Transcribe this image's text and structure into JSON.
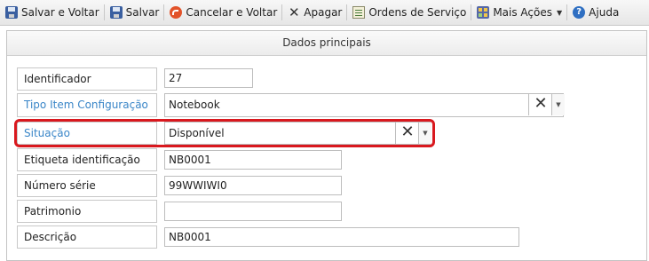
{
  "toolbar": {
    "save_back": "Salvar e Voltar",
    "save": "Salvar",
    "cancel_back": "Cancelar e Voltar",
    "delete": "Apagar",
    "service_orders": "Ordens de Serviço",
    "more_actions": "Mais Ações",
    "help": "Ajuda"
  },
  "panel": {
    "title": "Dados principais"
  },
  "form": {
    "identificador": {
      "label": "Identificador",
      "value": "27"
    },
    "tipo_item": {
      "label": "Tipo Item Configuração",
      "value": "Notebook"
    },
    "situacao": {
      "label": "Situação",
      "value": "Disponível"
    },
    "etiqueta": {
      "label": "Etiqueta identificação",
      "value": "NB0001"
    },
    "numero_serie": {
      "label": "Número série",
      "value": "99WWIWI0"
    },
    "patrimonio": {
      "label": "Patrimonio",
      "value": ""
    },
    "descricao": {
      "label": "Descrição",
      "value": "NB0001"
    }
  },
  "colors": {
    "link_label": "#3a86c8",
    "highlight": "#d9181e"
  },
  "icons": {
    "save_back": "floppy-icon",
    "save": "floppy-icon",
    "cancel_back": "cancel-icon",
    "delete": "x-icon",
    "service_orders": "orders-icon",
    "more_actions": "more-actions-icon",
    "help": "help-icon"
  }
}
